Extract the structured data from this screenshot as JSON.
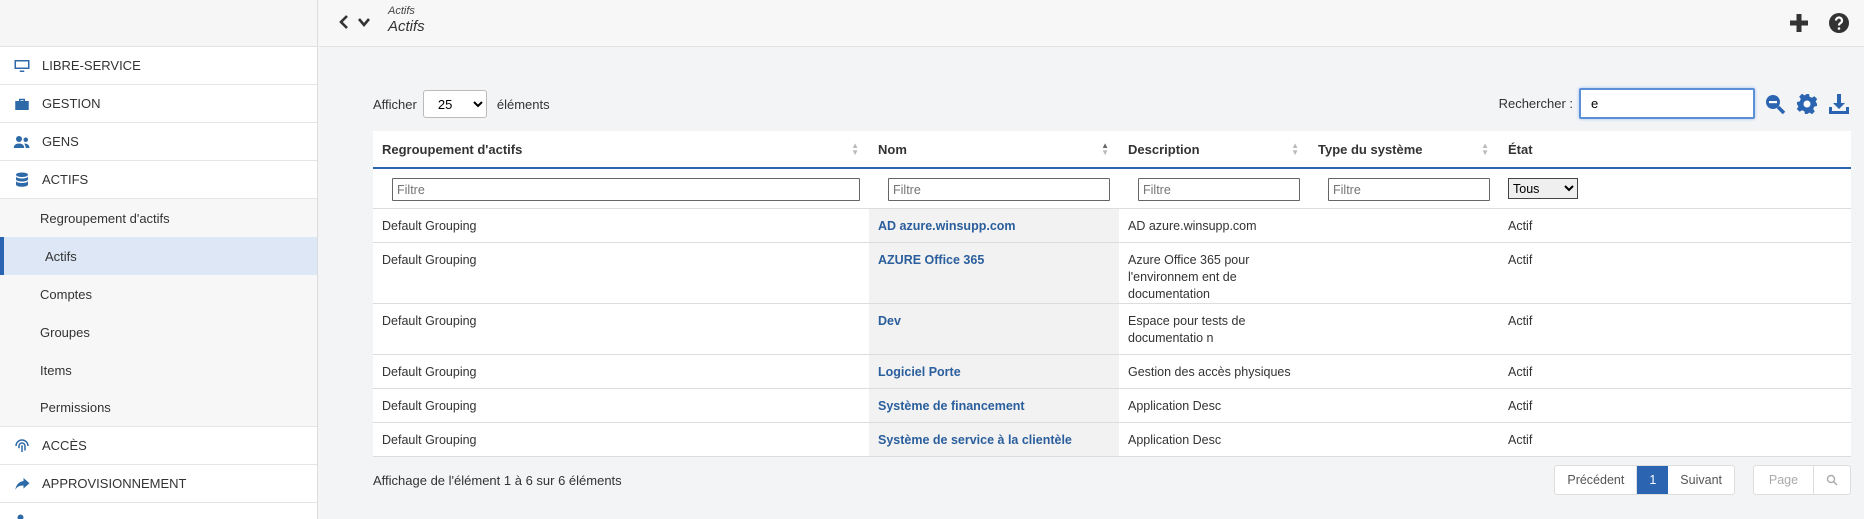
{
  "header": {
    "breadcrumb": "Actifs",
    "title": "Actifs"
  },
  "sidebar": {
    "items": [
      {
        "label": "LIBRE-SERVICE",
        "icon": "monitor-icon"
      },
      {
        "label": "GESTION",
        "icon": "toolbox-icon"
      },
      {
        "label": "GENS",
        "icon": "users-icon"
      },
      {
        "label": "ACTIFS",
        "icon": "database-icon"
      }
    ],
    "sub_items": [
      {
        "label": "Regroupement d'actifs",
        "active": false
      },
      {
        "label": "Actifs",
        "active": true
      },
      {
        "label": "Comptes",
        "active": false
      },
      {
        "label": "Groupes",
        "active": false
      },
      {
        "label": "Items",
        "active": false
      },
      {
        "label": "Permissions",
        "active": false
      }
    ],
    "bottom_items": [
      {
        "label": "ACCÈS",
        "icon": "fingerprint-icon"
      },
      {
        "label": "APPROVISIONNEMENT",
        "icon": "share-arrow-icon"
      }
    ]
  },
  "controls": {
    "show_label": "Afficher",
    "page_size": "25",
    "elements_label": "éléments",
    "search_label": "Rechercher :",
    "search_value": "e"
  },
  "table": {
    "columns": [
      "Regroupement d'actifs",
      "Nom",
      "Description",
      "Type du système",
      "État"
    ],
    "filter_placeholder": "Filtre",
    "state_filter": "Tous",
    "rows": [
      {
        "group": "Default Grouping",
        "name": "AD azure.winsupp.com",
        "description": "AD azure.winsupp.com",
        "system_type": "",
        "state": "Actif"
      },
      {
        "group": "Default Grouping",
        "name": "AZURE Office 365",
        "description": "Azure Office 365 pour l'environnem ent de documentation",
        "system_type": "",
        "state": "Actif"
      },
      {
        "group": "Default Grouping",
        "name": "Dev",
        "description": "Espace pour tests de documentatio n",
        "system_type": "",
        "state": "Actif"
      },
      {
        "group": "Default Grouping",
        "name": "Logiciel Porte",
        "description": "Gestion des accès physiques",
        "system_type": "",
        "state": "Actif"
      },
      {
        "group": "Default Grouping",
        "name": "Système de financement",
        "description": "Application Desc",
        "system_type": "",
        "state": "Actif"
      },
      {
        "group": "Default Grouping",
        "name": "Système de service à la clientèle",
        "description": "Application Desc",
        "system_type": "",
        "state": "Actif"
      }
    ]
  },
  "footer": {
    "info": "Affichage de l'élément 1 à 6 sur 6 éléments",
    "prev": "Précédent",
    "current_page": "1",
    "next": "Suivant",
    "page_placeholder": "Page"
  },
  "colors": {
    "accent": "#2b64b0",
    "link": "#2a5e9c",
    "active_bg": "#dde7f5"
  }
}
